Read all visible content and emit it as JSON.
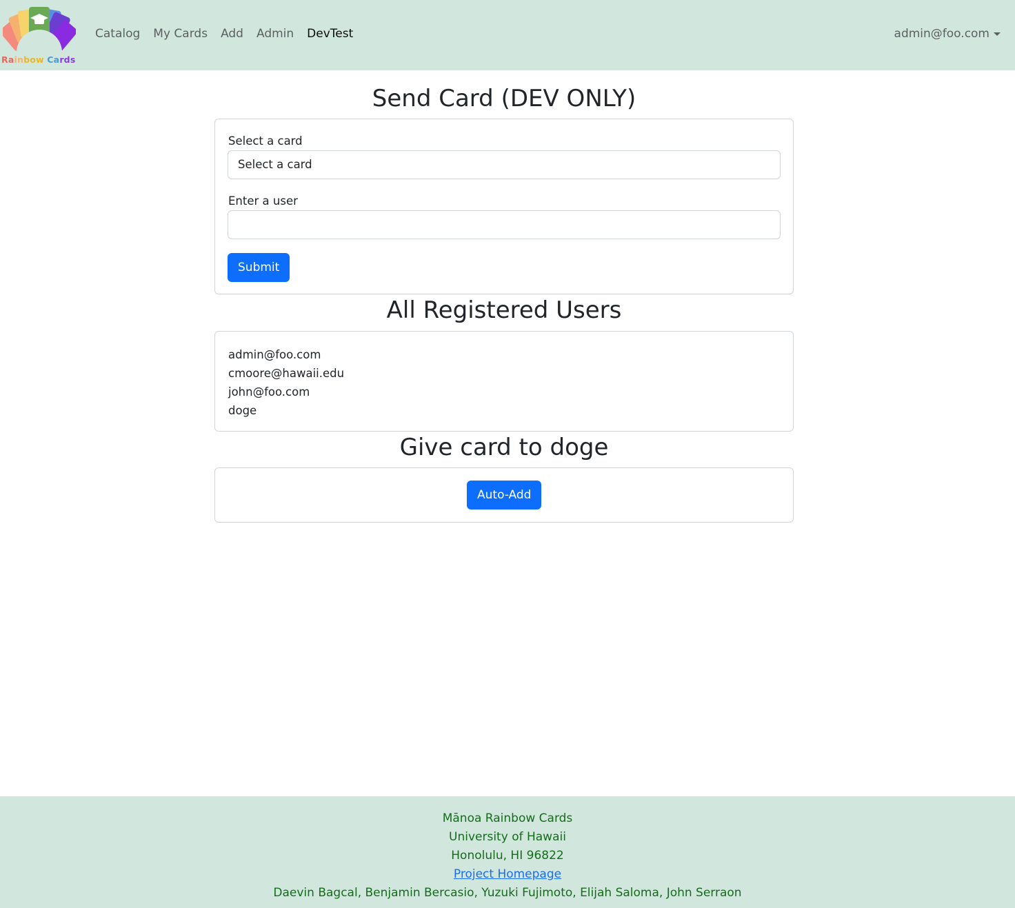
{
  "brand": {
    "name_parts": [
      {
        "text": "Ra",
        "color": "#e8675d"
      },
      {
        "text": "in",
        "color": "#f6b26b"
      },
      {
        "text": "bow",
        "color": "#e6b830"
      },
      {
        "text": " Ca",
        "color": "#4a9ad8"
      },
      {
        "text": "rds",
        "color": "#8a3ce0"
      }
    ],
    "logo_icon": "graduation-cap-icon"
  },
  "nav": {
    "links": [
      {
        "label": "Catalog",
        "active": false
      },
      {
        "label": "My Cards",
        "active": false
      },
      {
        "label": "Add",
        "active": false
      },
      {
        "label": "Admin",
        "active": false
      },
      {
        "label": "DevTest",
        "active": true
      }
    ],
    "user": "admin@foo.com"
  },
  "send_card": {
    "title": "Send Card (DEV ONLY)",
    "card_label": "Select a card",
    "card_selected": "Select a card",
    "user_label": "Enter a user",
    "user_value": "",
    "submit_label": "Submit"
  },
  "users": {
    "title": "All Registered Users",
    "list": [
      "admin@foo.com",
      "cmoore@hawaii.edu",
      "john@foo.com",
      "doge"
    ]
  },
  "give_card": {
    "title": "Give card to doge",
    "button_label": "Auto-Add"
  },
  "footer": {
    "line1": "Mānoa Rainbow Cards",
    "line2": "University of Hawaii",
    "line3": "Honolulu, HI 96822",
    "link_label": "Project Homepage",
    "authors": "Daevin Bagcal, Benjamin Bercasio, Yuzuki Fujimoto, Elijah Saloma, John Serraon"
  },
  "colors": {
    "navbar_bg": "#d1e7dd",
    "primary": "#0d6efd",
    "footer_text": "#146c1a",
    "link": "#1a6cf0"
  }
}
